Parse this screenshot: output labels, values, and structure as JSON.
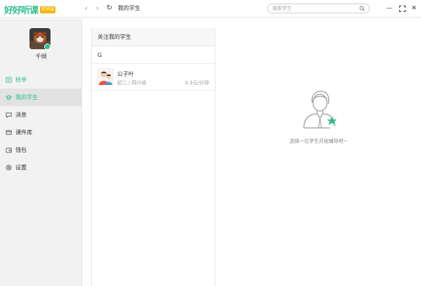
{
  "app": {
    "logo_text": "好好听课",
    "logo_badge": "老师端"
  },
  "topbar": {
    "page_title": "我的学生",
    "search_placeholder": "搜索学生",
    "back_icon": "chevron-left-icon",
    "forward_icon": "chevron-right-icon",
    "refresh_icon": "refresh-icon"
  },
  "profile": {
    "name": "千倾"
  },
  "sidebar": {
    "items": [
      {
        "label": "抢单",
        "icon": "grab-order-icon"
      },
      {
        "label": "我的学生",
        "icon": "student-icon"
      },
      {
        "label": "消息",
        "icon": "message-icon"
      },
      {
        "label": "课件库",
        "icon": "courseware-icon"
      },
      {
        "label": "钱包",
        "icon": "wallet-icon"
      },
      {
        "label": "设置",
        "icon": "settings-icon"
      }
    ]
  },
  "student_list": {
    "header": "关注我的学生",
    "groups": [
      {
        "letter": "G",
        "students": [
          {
            "name": "公子叶",
            "info": "初二 / 四川省",
            "rate": "0.3元/分钟"
          }
        ]
      }
    ]
  },
  "detail": {
    "empty_text": "选择一位学生开始辅导吧~"
  },
  "colors": {
    "accent": "#2dbf8a",
    "badge": "#f5b300",
    "sidebar_bg": "#f2f2f2",
    "active_bg": "#e2e2e2"
  }
}
